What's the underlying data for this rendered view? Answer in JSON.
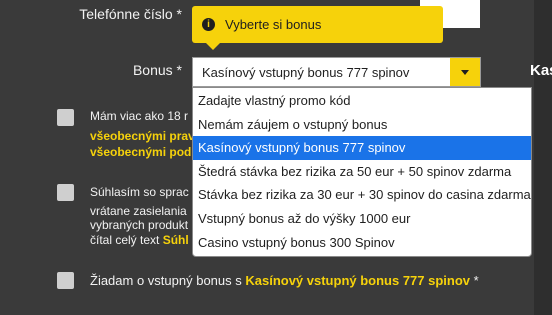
{
  "form": {
    "phone_label": "Telefónne číslo *",
    "bonus_label": "Bonus *",
    "side_heading": "Kas"
  },
  "tooltip": {
    "icon": "info-icon",
    "text": "Vyberte si bonus"
  },
  "select": {
    "value": "Kasínový vstupný bonus 777 spinov"
  },
  "dropdown": {
    "options": [
      "Zadajte vlastný promo kód",
      "Nemám záujem o vstupný bonus",
      "Kasínový vstupný bonus 777 spinov",
      "Štedrá stávka bez rizika za 50 eur + 50 spinov zdarma",
      "Stávka bez rizika za 30 eur + 30 spinov do casina zdarma",
      "Vstupný bonus až do výšky 1000 eur",
      "Casino vstupný bonus 300 Spinov"
    ],
    "selected_index": 2
  },
  "checkboxes": {
    "age_line1": "Mám viac ako 18 r",
    "age_line2": "všeobecnými prav",
    "age_line3": "všeobecnými podm",
    "consent_line1": "Súhlasím so sprac",
    "consent_line2": "vrátane zasielania",
    "consent_line3": "vybraných produkt",
    "consent_line4a": "čítal celý text ",
    "consent_line4b": "Súhl",
    "bonus_prefix": "Žiadam o vstupný bonus s ",
    "bonus_name": "Kasínový vstupný bonus 777 spinov",
    "bonus_suffix": " *"
  },
  "colors": {
    "background": "#3a3a3a",
    "accent": "#f6d20b",
    "selected": "#1a73e8"
  }
}
